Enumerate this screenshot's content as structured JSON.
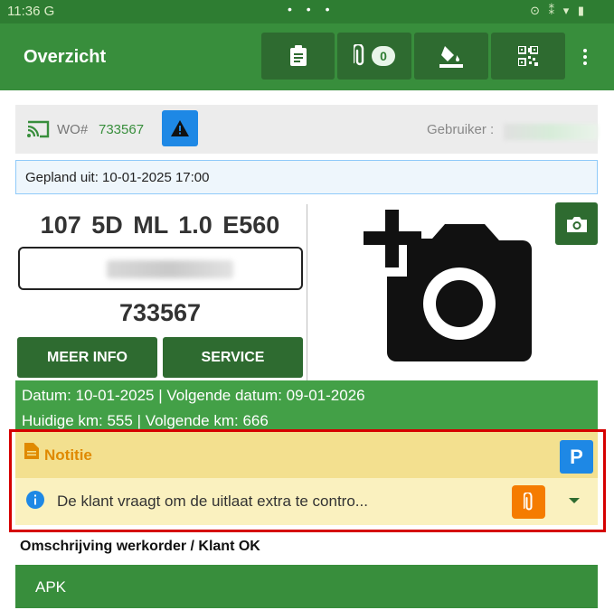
{
  "statusbar": {
    "time": "11:36 G",
    "dots": "• • •",
    "icons": "⊙ ⁑ ▾ ▮"
  },
  "appbar": {
    "title": "Overzicht",
    "attachments_count": "0"
  },
  "wo": {
    "label": "WO#",
    "number": "733567",
    "user_label": "Gebruiker :"
  },
  "planned": "Gepland uit: 10-01-2025 17:00",
  "vehicle": {
    "title": "107 5D ML 1.0   E560",
    "number": "733567",
    "more_info_label": "MEER INFO",
    "service_label": "SERVICE"
  },
  "dates": {
    "line1": "Datum: 10-01-2025 | Volgende datum: 09-01-2026",
    "line2": "Huidige km: 555 | Volgende km: 666"
  },
  "note": {
    "header": "Notitie",
    "p_label": "P",
    "text": "De klant vraagt om de uitlaat extra te contro..."
  },
  "description_title": "Omschrijving werkorder / Klant OK",
  "section_apk": "APK",
  "colors": {
    "primary": "#388e3c",
    "dark": "#2e6b30",
    "accent_blue": "#1e88e5",
    "note_orange": "#f57c00",
    "highlight": "#d50000"
  }
}
